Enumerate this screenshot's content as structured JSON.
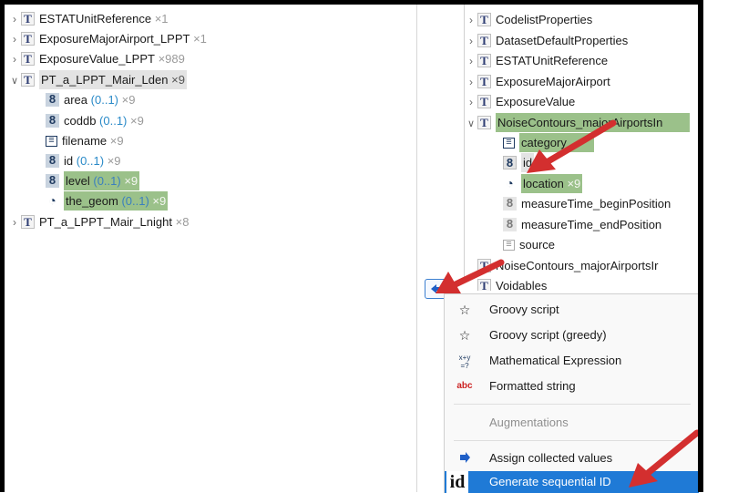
{
  "left_tree": {
    "items": [
      {
        "name": "ESTATUnitReference",
        "mult": "×1"
      },
      {
        "name": "ExposureMajorAirport_LPPT",
        "mult": "×1"
      },
      {
        "name": "ExposureValue_LPPT",
        "mult": "×989"
      },
      {
        "name": "PT_a_LPPT_Mair_Lden",
        "mult": "×9"
      },
      {
        "name": "area",
        "card": "(0..1)",
        "mult": "×9"
      },
      {
        "name": "coddb",
        "card": "(0..1)",
        "mult": "×9"
      },
      {
        "name": "filename",
        "mult": "×9"
      },
      {
        "name": "id",
        "card": "(0..1)",
        "mult": "×9"
      },
      {
        "name": "level",
        "card": "(0..1)",
        "mult": "×9"
      },
      {
        "name": "the_geom",
        "card": "(0..1)",
        "mult": "×9"
      },
      {
        "name": "PT_a_LPPT_Mair_Lnight",
        "mult": "×8"
      }
    ]
  },
  "right_tree": {
    "items": [
      {
        "name": "CodelistProperties"
      },
      {
        "name": "DatasetDefaultProperties"
      },
      {
        "name": "ESTATUnitReference"
      },
      {
        "name": "ExposureMajorAirport"
      },
      {
        "name": "ExposureValue"
      },
      {
        "name": "NoiseContours_majorAirportsIn"
      },
      {
        "name": "category"
      },
      {
        "name": "id"
      },
      {
        "name": "location",
        "mult": "×9"
      },
      {
        "name": "measureTime_beginPosition"
      },
      {
        "name": "measureTime_endPosition"
      },
      {
        "name": "source"
      },
      {
        "name": "NoiseContours_majorAirportsIr"
      },
      {
        "name": "Voidables"
      }
    ]
  },
  "context_menu": {
    "items": [
      {
        "label": "Groovy script",
        "icon": "star-outline-icon"
      },
      {
        "label": "Groovy script (greedy)",
        "icon": "star-outline-icon"
      },
      {
        "label": "Mathematical Expression",
        "icon": "math-expression-icon",
        "icon_text": "x+y\n=?"
      },
      {
        "label": "Formatted string",
        "icon": "abc-icon",
        "icon_text": "abc"
      },
      {
        "label": "Augmentations"
      },
      {
        "label": "Assign collected values",
        "icon": "blue-arrow-icon"
      },
      {
        "label": "Generate sequential ID",
        "icon": "id-icon",
        "icon_text": "id"
      }
    ]
  },
  "colors": {
    "highlight_green": "#9bc18a",
    "selected_blue": "#1f7ad6",
    "annotation_arrow": "#d32f2f"
  }
}
